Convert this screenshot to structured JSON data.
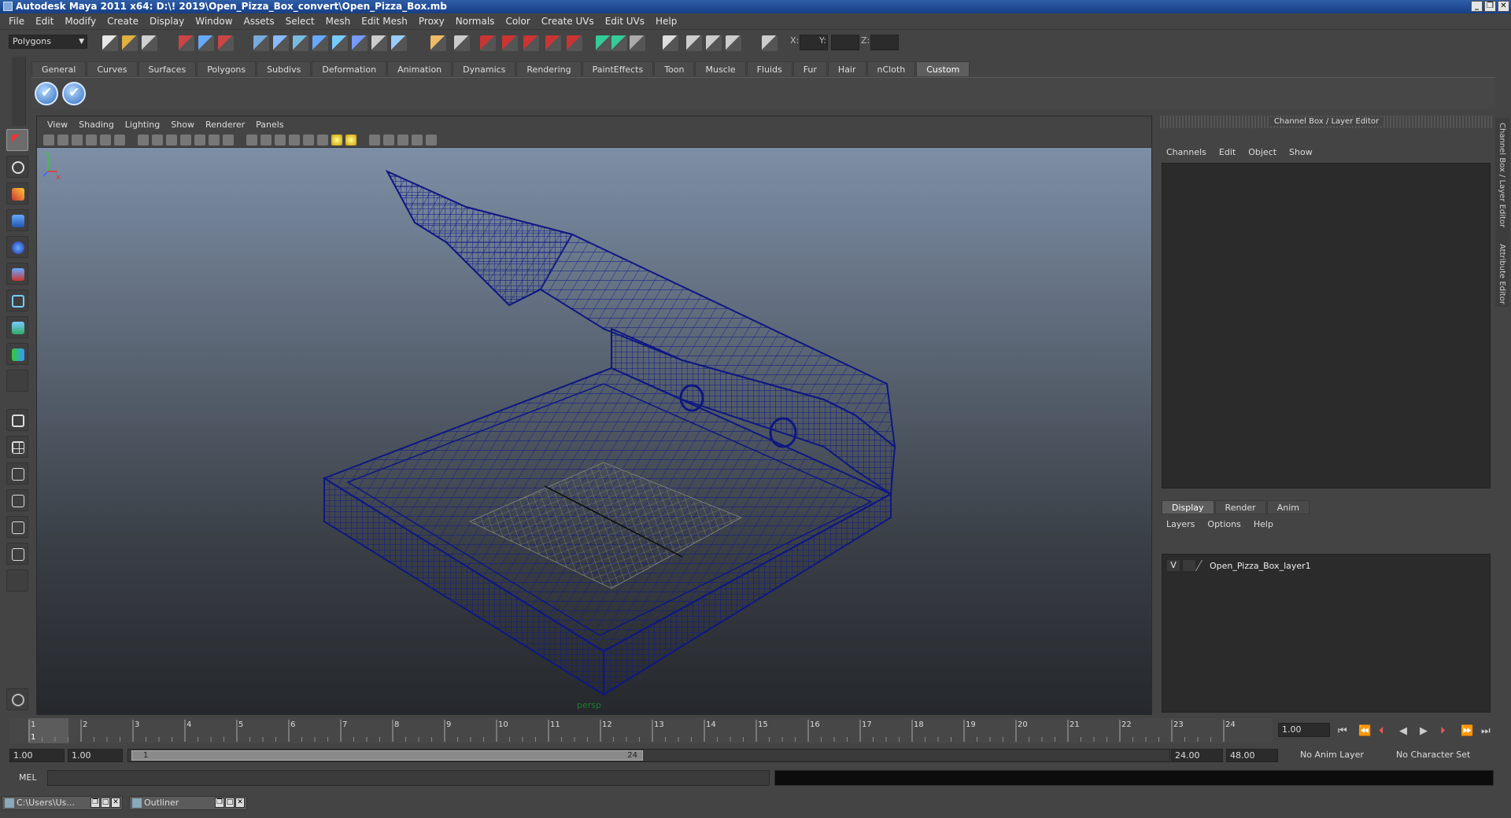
{
  "window": {
    "title": "Autodesk Maya 2011 x64: D:\\! 2019\\Open_Pizza_Box_convert\\Open_Pizza_Box.mb",
    "buttons": [
      "_",
      "❐",
      "✕"
    ]
  },
  "menubar": [
    "File",
    "Edit",
    "Modify",
    "Create",
    "Display",
    "Window",
    "Assets",
    "Select",
    "Mesh",
    "Edit Mesh",
    "Proxy",
    "Normals",
    "Color",
    "Create UVs",
    "Edit UVs",
    "Help"
  ],
  "statusline": {
    "mode": "Polygons",
    "x_label": "X:",
    "y_label": "Y:",
    "z_label": "Z:"
  },
  "shelf": {
    "tabs": [
      "General",
      "Curves",
      "Surfaces",
      "Polygons",
      "Subdivs",
      "Deformation",
      "Animation",
      "Dynamics",
      "Rendering",
      "PaintEffects",
      "Toon",
      "Muscle",
      "Fluids",
      "Fur",
      "Hair",
      "nCloth",
      "Custom"
    ],
    "active_tab": "Custom"
  },
  "viewport": {
    "menu": [
      "View",
      "Shading",
      "Lighting",
      "Show",
      "Renderer",
      "Panels"
    ],
    "camera_label": "persp",
    "axis_x": "x",
    "axis_y": "y"
  },
  "channel_box": {
    "title": "Channel Box / Layer Editor",
    "menu": [
      "Channels",
      "Edit",
      "Object",
      "Show"
    ]
  },
  "layer_editor": {
    "tabs": [
      "Display",
      "Render",
      "Anim"
    ],
    "active_tab": "Display",
    "menu": [
      "Layers",
      "Options",
      "Help"
    ],
    "layer": {
      "visibility": "V",
      "name": "Open_Pizza_Box_layer1"
    }
  },
  "side_tabs": [
    "Channel Box / Layer Editor",
    "Attribute Editor"
  ],
  "timeline": {
    "ticks": [
      "1",
      "2",
      "3",
      "4",
      "5",
      "6",
      "7",
      "8",
      "9",
      "10",
      "11",
      "12",
      "13",
      "14",
      "15",
      "16",
      "17",
      "18",
      "19",
      "20",
      "21",
      "22",
      "23",
      "24"
    ],
    "current_frame_marker": "1",
    "current_frame": "1.00"
  },
  "range": {
    "start": "1.00",
    "playback_start": "1.00",
    "handle_start": "1",
    "handle_end": "24",
    "playback_end": "24.00",
    "end": "48.00",
    "anim_layer": "No Anim Layer",
    "character_set": "No Character Set"
  },
  "command_line": {
    "label": "MEL"
  },
  "taskbar": [
    {
      "label": "C:\\Users\\Us..."
    },
    {
      "label": "Outliner"
    }
  ]
}
